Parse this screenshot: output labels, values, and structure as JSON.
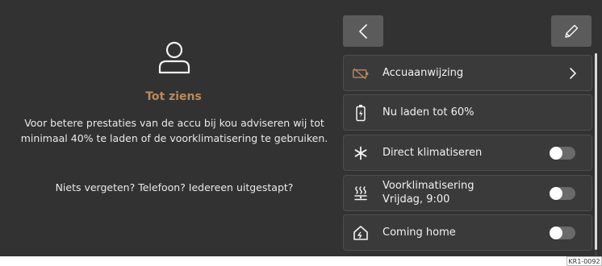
{
  "left_panel": {
    "farewell_title": "Tot ziens",
    "advice_text": "Voor betere prestaties van de accu bij kou adviseren wij tot minimaal 40% te laden of de voorklimatisering te gebruiken.",
    "reminder_text": "Niets vergeten? Telefoon? Iedereen uitgestapt?",
    "icon": "person-icon"
  },
  "toolbar": {
    "back_icon": "chevron-left-icon",
    "edit_icon": "pencil-icon"
  },
  "tiles": [
    {
      "label": "Accuaanwijzing",
      "icon": "battery-crossed-icon",
      "control": "chevron"
    },
    {
      "label": "Nu laden tot 60%",
      "icon": "battery-charge-icon",
      "control": "none"
    },
    {
      "label": "Direct klimatiseren",
      "icon": "snowflake-icon",
      "control": "toggle",
      "enabled": false
    },
    {
      "label": "Voorklimatisering",
      "sublabel": "Vrijdag, 9:00",
      "icon": "heating-timer-icon",
      "control": "toggle",
      "enabled": false
    },
    {
      "label": "Coming home",
      "icon": "home-icon",
      "control": "toggle",
      "enabled": false
    }
  ],
  "image_reference": "KR1-0092",
  "colors": {
    "background": "#323232",
    "tile": "#3a3a3a",
    "button": "#5b5b5b",
    "accent": "#b98a5a",
    "battery_warning": "#b98a5a"
  }
}
